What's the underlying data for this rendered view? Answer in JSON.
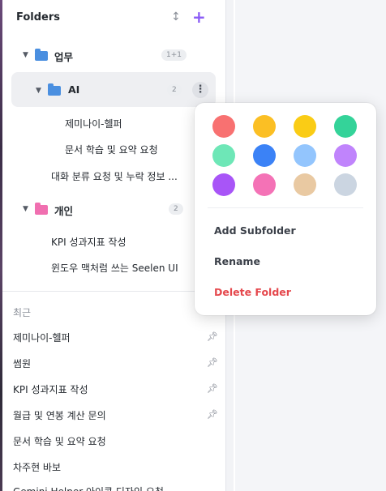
{
  "header": {
    "title": "Folders"
  },
  "folders": [
    {
      "label": "업무",
      "badge": "1+1",
      "color": "#4a8fe0"
    },
    {
      "label": "AI",
      "badge": "2",
      "color": "#4a8fe0"
    },
    {
      "label": "개인",
      "badge": "2",
      "color": "#f06fb0"
    }
  ],
  "chats": [
    "제미나이-헬퍼",
    "문서 학습 및 요약 요청",
    "대화 분류 요청 및 누락 정보 ...",
    "KPI 성과지표 작성",
    "윈도우 맥처럼 쓰는 Seelen UI"
  ],
  "recent": {
    "label": "최근",
    "items": [
      "제미나이-헬퍼",
      "썸원",
      "KPI 성과지표 작성",
      "월급 및 연봉 계산 문의",
      "문서 학습 및 요약 요청",
      "차주현 바보",
      "Gemini Helper 아이콘 디자인 요청"
    ]
  },
  "menu": {
    "colors": [
      "#f87171",
      "#fbbf24",
      "#facc15",
      "#34d399",
      "#6ee7b7",
      "#3b82f6",
      "#93c5fd",
      "#c084fc",
      "#a855f7",
      "#f472b6",
      "#e9c9a2",
      "#cbd5e1"
    ],
    "items": [
      "Add Subfolder",
      "Rename",
      "Delete Folder"
    ]
  }
}
